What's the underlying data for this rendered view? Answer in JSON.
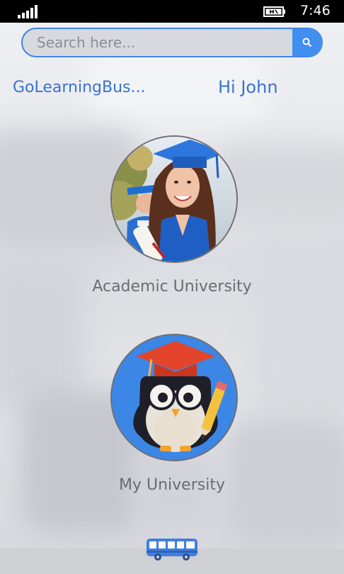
{
  "status_bar": {
    "time": "7:46",
    "icons": [
      "signal-strength-icon",
      "battery-charging-icon"
    ]
  },
  "search": {
    "placeholder": "Search here...",
    "value": "",
    "button_icon": "search-icon"
  },
  "header": {
    "brand": "GoLearningBus...",
    "greeting": "Hi John"
  },
  "cards": [
    {
      "label": "Academic University",
      "icon": "graduate-student-photo"
    },
    {
      "label": "My University",
      "icon": "owl-graduate-icon"
    }
  ],
  "app_bar": {
    "icon": "bus-icon"
  },
  "colors": {
    "accent": "#3f8ef0",
    "brand_text": "#3a72d0",
    "label_text": "#6c6c70",
    "app_bar": "#cfd0d4"
  }
}
